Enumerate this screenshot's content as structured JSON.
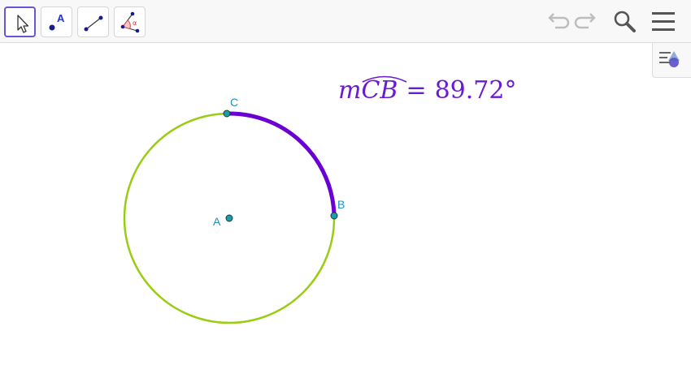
{
  "toolbar": {
    "tools": [
      {
        "name": "Move",
        "icon": "arrow-cursor-icon",
        "active": true
      },
      {
        "name": "Point",
        "icon": "point-icon",
        "point_label": "A"
      },
      {
        "name": "Segment",
        "icon": "segment-icon"
      },
      {
        "name": "Angle",
        "icon": "angle-icon",
        "angle_label": "α"
      }
    ],
    "right_icons": [
      "undo-icon",
      "redo-icon",
      "search-icon",
      "menu-icon"
    ]
  },
  "style_bar": {
    "icon": "style-bar-icon"
  },
  "graphics": {
    "points": [
      {
        "label": "A"
      },
      {
        "label": "B"
      },
      {
        "label": "C"
      }
    ],
    "measurement": {
      "prefix": "m",
      "arc": "CB",
      "equals": "=",
      "value": "89.72°"
    }
  },
  "colors": {
    "circle": "#9acd12",
    "arc": "#6a00d4",
    "point_fill": "#1a9ea8",
    "point_label": "#1a93c5",
    "measurement_text": "#6a1ad1",
    "active_tool_border": "#6557d2",
    "disabled_icon": "#bdbdbd",
    "icon_dark": "#555555"
  }
}
